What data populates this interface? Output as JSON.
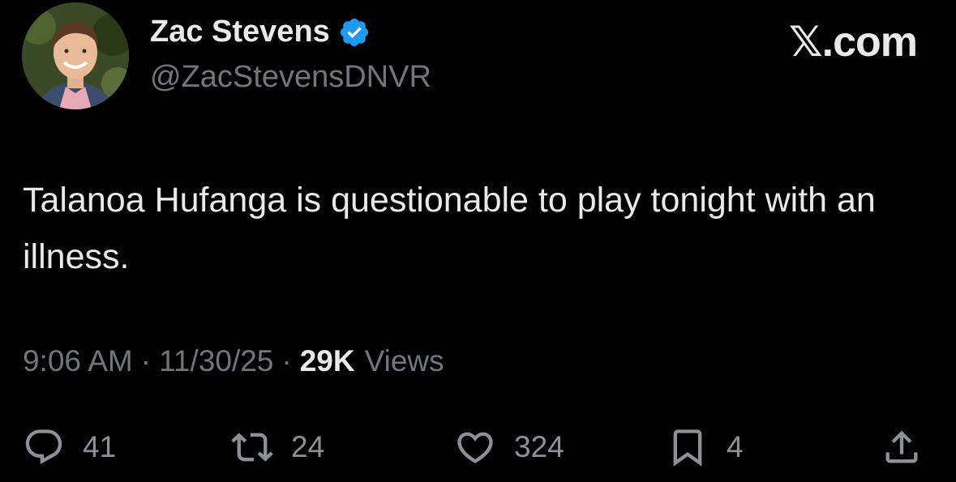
{
  "author": {
    "display_name": "Zac Stevens",
    "handle": "@ZacStevensDNVR",
    "avatar_icon": "profile-photo",
    "verified_icon": "verified-badge-icon",
    "verified_color": "#1d9bf0"
  },
  "brand": {
    "label": "𝕏.com"
  },
  "tweet": {
    "text": "Talanoa Hufanga is questionable to play tonight with an illness."
  },
  "meta": {
    "time": "9:06 AM",
    "separator": "·",
    "date": "11/30/25",
    "views_count": "29K",
    "views_label": "Views"
  },
  "actions": {
    "replies": {
      "icon": "reply-icon",
      "count": "41"
    },
    "reposts": {
      "icon": "repost-icon",
      "count": "24"
    },
    "likes": {
      "icon": "heart-icon",
      "count": "324"
    },
    "bookmarks": {
      "icon": "bookmark-icon",
      "count": "4"
    },
    "share": {
      "icon": "share-icon"
    }
  },
  "colors": {
    "background": "#000000",
    "primary_text": "#e7e9ea",
    "secondary_text": "#71767b"
  }
}
